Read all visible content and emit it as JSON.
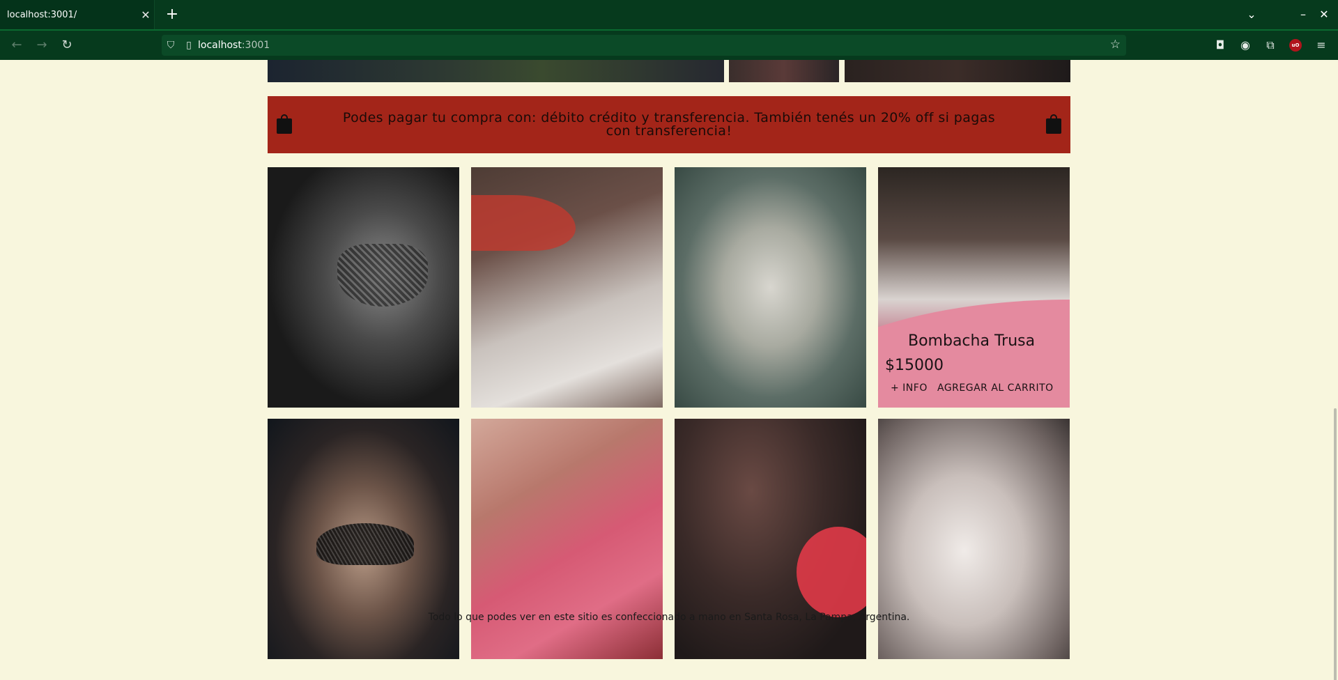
{
  "browser": {
    "tab_title": "localhost:3001/",
    "tab_close": "✕",
    "new_tab": "+",
    "url_host": "localhost",
    "url_rest": ":3001",
    "window_controls": {
      "list": "⌄",
      "minimize": "–",
      "close": "✕"
    }
  },
  "banner": {
    "text": "Podes pagar tu compra con: débito crédito y transferencia. También tenés un 20% off si pagas con transferencia!"
  },
  "products": [
    {
      "id": 1
    },
    {
      "id": 2
    },
    {
      "id": 3
    },
    {
      "id": 4,
      "hover": true,
      "name": "Bombacha Trusa",
      "price": "$15000",
      "info_label": "+ INFO",
      "cart_label": "AGREGAR AL CARRITO"
    },
    {
      "id": 5
    },
    {
      "id": 6
    },
    {
      "id": 7
    },
    {
      "id": 8
    }
  ],
  "footer": {
    "text": "Todo lo que podes ver en este sitio es confeccionado a mano en Santa Rosa, La Pampa, Argentina."
  },
  "colors": {
    "page_bg": "#f8f6dd",
    "banner_bg": "#a32519",
    "overlay_pink": "#e48a9f",
    "browser_chrome": "#063a1d"
  }
}
